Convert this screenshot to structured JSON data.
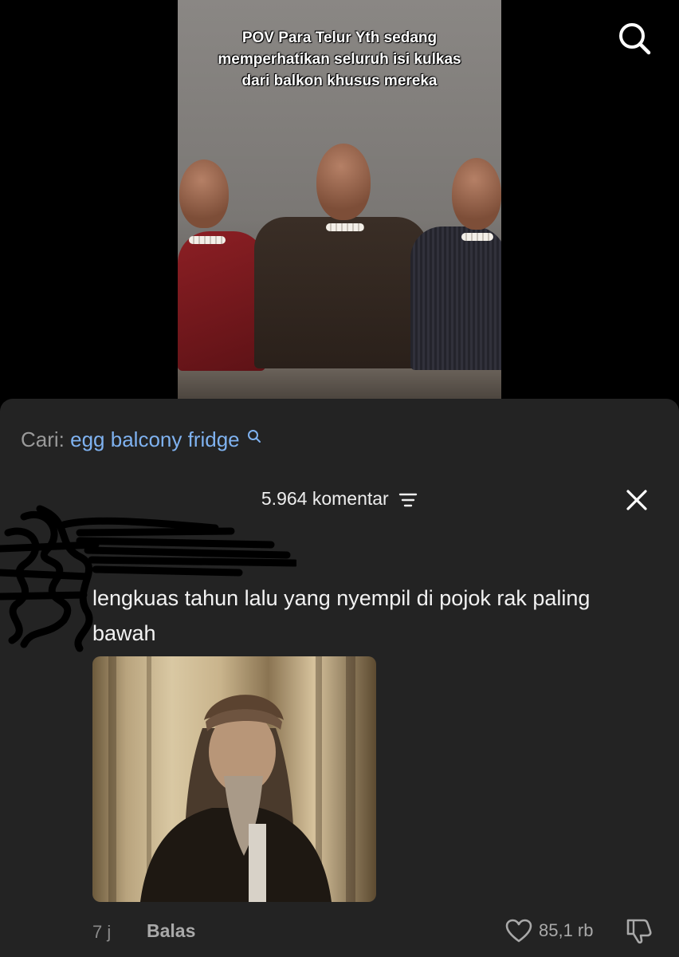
{
  "video": {
    "caption": "POV Para Telur Yth sedang\nmemperhatikan seluruh isi kulkas\ndari balkon khusus mereka"
  },
  "search_suggestion": {
    "prefix": "Cari:",
    "query": "egg balcony fridge"
  },
  "comments": {
    "count_label": "5.964 komentar",
    "items": [
      {
        "text": "lengkuas tahun lalu yang nyempil di pojok rak paling bawah",
        "time": "7 j",
        "reply_label": "Balas",
        "likes": "85,1 rb"
      }
    ]
  },
  "colors": {
    "sheet_bg": "#232323",
    "link_blue": "#7fb2f0",
    "muted_text": "#a9a9a9"
  },
  "icons": [
    "search-icon",
    "search-small-icon",
    "filter-icon",
    "close-icon",
    "heart-icon",
    "dislike-icon"
  ]
}
